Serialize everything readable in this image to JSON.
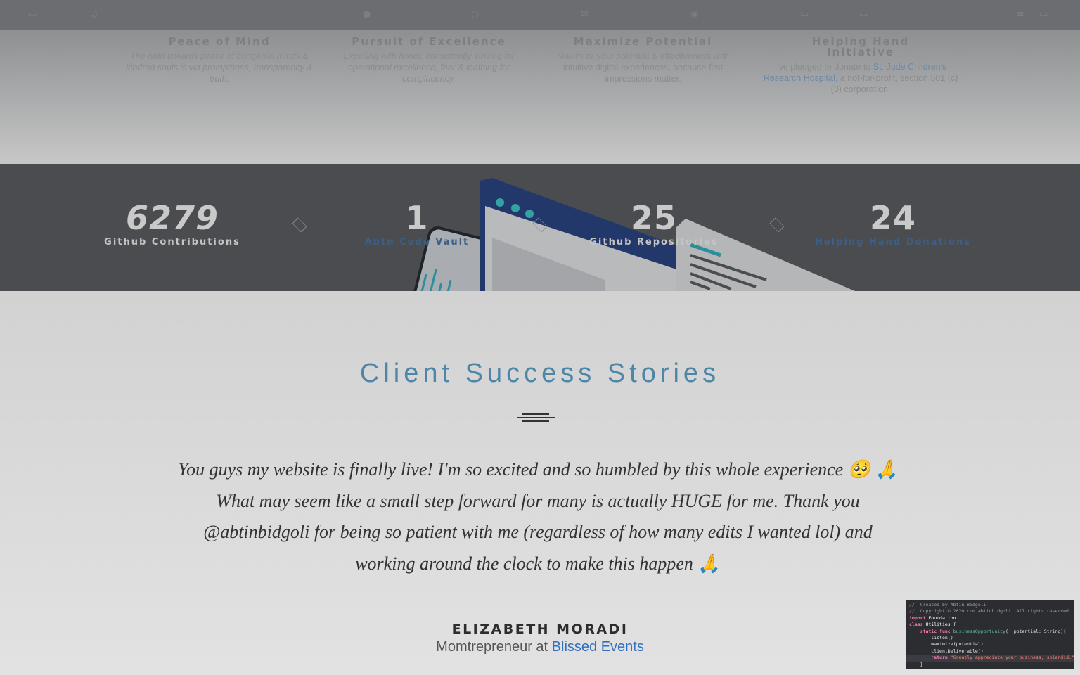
{
  "features": [
    {
      "title": "Peace of Mind",
      "text": "The path towards peace of congenial minds & kindred souls is via promptness, transparency & truth."
    },
    {
      "title": "Pursuit of Excellence",
      "text": "Excelling with honor, consistently striving for operational excellence, fear & loathing for complacency."
    },
    {
      "title": "Maximize Potential",
      "text": "Maximize your potential & effectiveness with intuitive digital experiences, because first impressions matter."
    },
    {
      "title": "Helping Hand Initiative",
      "text_before": "I've pledged to donate to ",
      "link": "St. Jude Children's Research Hospital",
      "text_after": ", a not-for-profit, section 501 (c)(3) corporation."
    }
  ],
  "stats": [
    {
      "number": "6279",
      "label": "Github Contributions"
    },
    {
      "number": "1",
      "label": "Abtn Code Vault"
    },
    {
      "number": "25",
      "label": "Github Repositories"
    },
    {
      "number": "24",
      "label": "Helping Hand Donations"
    }
  ],
  "testimonials": {
    "title": "Client Success Stories",
    "quote": "You guys my website is finally live! I'm so excited and so humbled by this whole experience 🥺 🙏 What may seem like a small step forward for many is actually HUGE for me. Thank you @abtinbidgoli for being so patient with me (regardless of how many edits I wanted lol) and working around the clock to make this happen 🙏",
    "author_name": "ELIZABETH MORADI",
    "author_role": "Momtrepreneur at ",
    "author_company": "Blissed Events"
  },
  "code_widget": {
    "line1": "//  Created by Abtin Bidgoli",
    "line2": "//  Copyright © 2020 com.abtinbidgoli. All rights reserved.",
    "line3_kw": "import",
    "line3_rest": " Foundation",
    "line4_kw": "class",
    "line4_name": " Utilities",
    "line4_rest": " {",
    "line5_kw": "    static func",
    "line5_fn": " businessOpportunity",
    "line5_rest": "(_ potential: String){",
    "line6": "        listen()",
    "line7": "        maximize(potential)",
    "line8": "        clientDeliverable()",
    "line9_kw": "        return",
    "line9_str": " \"Greatly appreciate your business, splendid.\"",
    "line10": "    }"
  }
}
